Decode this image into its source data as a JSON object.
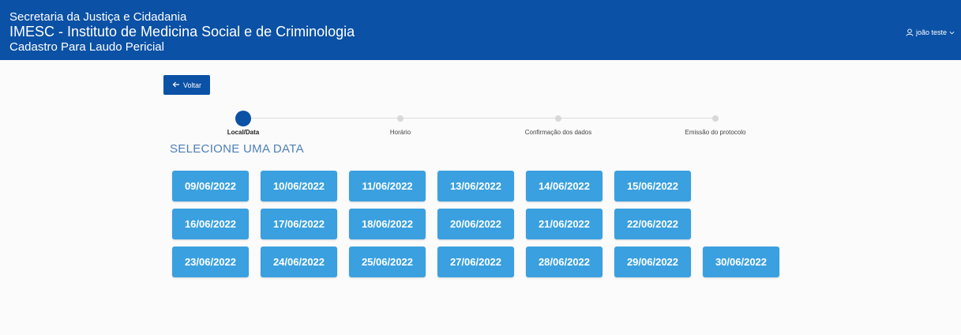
{
  "header": {
    "line1": "Secretaria da Justiça e Cidadania",
    "line2": "IMESC - Instituto de Medicina Social e de Criminologia",
    "line3": "Cadastro Para Laudo Pericial",
    "user_name": "joão teste",
    "user_icon": "user-icon",
    "dropdown_icon": "chevron-down-icon"
  },
  "back_button": {
    "label": "Voltar",
    "icon": "arrow-left-icon"
  },
  "steps": [
    {
      "label": "Local/Data",
      "active": true
    },
    {
      "label": "Horário",
      "active": false
    },
    {
      "label": "Confirmação dos dados",
      "active": false
    },
    {
      "label": "Emissão do protocolo",
      "active": false
    }
  ],
  "section_title": "SELECIONE UMA DATA",
  "dates": [
    [
      "09/06/2022",
      "10/06/2022",
      "11/06/2022",
      "13/06/2022",
      "14/06/2022",
      "15/06/2022"
    ],
    [
      "16/06/2022",
      "17/06/2022",
      "18/06/2022",
      "20/06/2022",
      "21/06/2022",
      "22/06/2022"
    ],
    [
      "23/06/2022",
      "24/06/2022",
      "25/06/2022",
      "27/06/2022",
      "28/06/2022",
      "29/06/2022",
      "30/06/2022"
    ]
  ],
  "colors": {
    "brand": "#0b51a5",
    "date_button": "#3aa0df",
    "title": "#4e7fb8"
  }
}
